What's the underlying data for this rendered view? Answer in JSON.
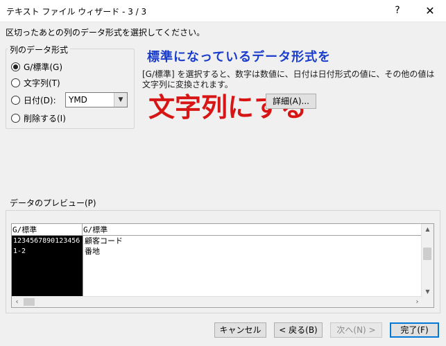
{
  "window": {
    "title": "テキスト ファイル ウィザード - 3 / 3",
    "help_label": "?",
    "close_label": "✕"
  },
  "instruction": "区切ったあとの列のデータ形式を選択してください。",
  "column_format": {
    "legend": "列のデータ形式",
    "options": [
      {
        "label": "G/標準(G)",
        "checked": true
      },
      {
        "label": "文字列(T)",
        "checked": false
      },
      {
        "label": "日付(D):",
        "checked": false
      },
      {
        "label": "削除する(I)",
        "checked": false
      }
    ],
    "date_format": {
      "value": "YMD",
      "dropdown_icon": "chevron-down"
    }
  },
  "annotations": {
    "blue": "標準になっているデータ形式を",
    "red": "文字列にする"
  },
  "description": "[G/標準] を選択すると、数字は数値に、日付は日付形式の値に、その他の値は文字列に変換されます。",
  "detail_button": "詳細(A)...",
  "preview": {
    "label": "データのプレビュー(P)",
    "columns": [
      {
        "header": "G/標準",
        "cells": [
          "1234567890123456",
          "1-2"
        ]
      },
      {
        "header": "G/標準",
        "cells": [
          "顧客コード",
          "番地"
        ]
      }
    ]
  },
  "buttons": {
    "cancel": "キャンセル",
    "back": "< 戻る(B)",
    "next": "次へ(N) >",
    "finish": "完了(F)"
  },
  "colors": {
    "annotation_blue": "#1a3ccc",
    "annotation_red": "#d81515",
    "accent": "#0078d7"
  }
}
